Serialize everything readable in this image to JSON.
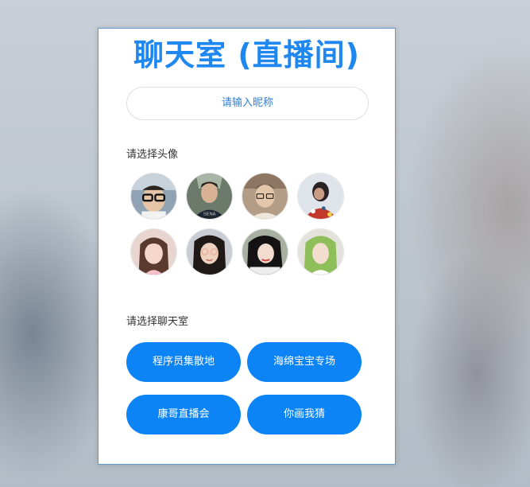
{
  "app": {
    "title": "聊天室 (直播间)"
  },
  "nickname": {
    "placeholder": "请输入昵称"
  },
  "avatar_section": {
    "label": "请选择头像",
    "avatars": [
      {
        "name": "avatar-1-icon"
      },
      {
        "name": "avatar-2-icon"
      },
      {
        "name": "avatar-3-icon"
      },
      {
        "name": "avatar-4-icon"
      },
      {
        "name": "avatar-5-icon"
      },
      {
        "name": "avatar-6-icon"
      },
      {
        "name": "avatar-7-icon"
      },
      {
        "name": "avatar-8-icon"
      }
    ]
  },
  "room_section": {
    "label": "请选择聊天室",
    "rooms": [
      {
        "label": "程序员集散地"
      },
      {
        "label": "海绵宝宝专场"
      },
      {
        "label": "康哥直播会"
      },
      {
        "label": "你画我猜"
      }
    ]
  },
  "colors": {
    "accent": "#1f87f0",
    "button": "#0d84f5"
  }
}
